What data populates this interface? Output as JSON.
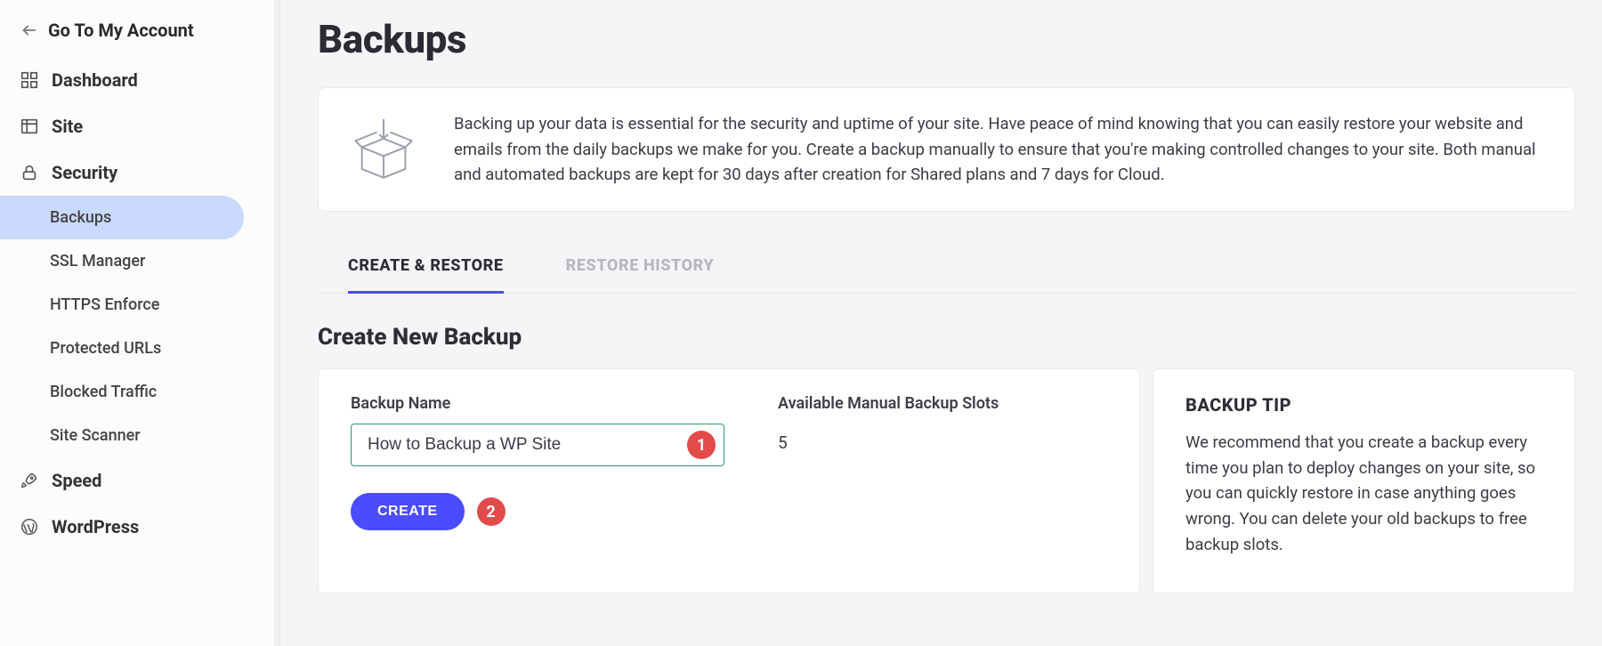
{
  "account_link": "Go To My Account",
  "sidebar": {
    "dashboard": "Dashboard",
    "site": "Site",
    "security": "Security",
    "security_items": {
      "backups": "Backups",
      "ssl": "SSL Manager",
      "https": "HTTPS Enforce",
      "protected": "Protected URLs",
      "blocked": "Blocked Traffic",
      "scanner": "Site Scanner"
    },
    "speed": "Speed",
    "wordpress": "WordPress"
  },
  "page": {
    "title": "Backups",
    "intro": "Backing up your data is essential for the security and uptime of your site. Have peace of mind knowing that you can easily restore your website and emails from the daily backups we make for you. Create a backup manually to ensure that you're making controlled changes to your site. Both manual and automated backups are kept for 30 days after creation for Shared plans and 7 days for Cloud."
  },
  "tabs": {
    "create": "CREATE & RESTORE",
    "history": "RESTORE HISTORY"
  },
  "section": {
    "create_title": "Create New Backup"
  },
  "form": {
    "name_label": "Backup Name",
    "name_value": "How to Backup a WP Site",
    "slots_label": "Available Manual Backup Slots",
    "slots_value": "5",
    "create_btn": "CREATE"
  },
  "annotations": {
    "step1": "1",
    "step2": "2"
  },
  "tip": {
    "title": "BACKUP TIP",
    "text": "We recommend that you create a backup every time you plan to deploy changes on your site, so you can quickly restore in case anything goes wrong. You can delete your old backups to free backup slots."
  }
}
